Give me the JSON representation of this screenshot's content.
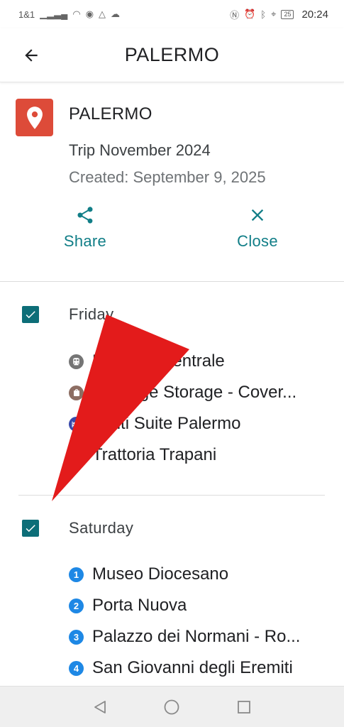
{
  "status_bar": {
    "carrier": "1&1",
    "time": "20:24",
    "battery": "25"
  },
  "app_bar": {
    "title": "PALERMO"
  },
  "map_header": {
    "name": "PALERMO",
    "description": "Trip November 2024",
    "created": "Created: September 9, 2025",
    "share_label": "Share",
    "close_label": "Close",
    "accent_color": "#117e87",
    "pin_color": "#dd4b39"
  },
  "days": [
    {
      "name": "Friday",
      "checked": true,
      "places": [
        {
          "text": "Palermo Centrale",
          "icon": "train-icon"
        },
        {
          "text": "Luggage Storage - Cover...",
          "icon": "shopping-bag-icon"
        },
        {
          "text": "Politi Suite Palermo",
          "icon": "hotel-icon"
        },
        {
          "text": "Trattoria Trapani",
          "icon": "restaurant-icon"
        }
      ]
    },
    {
      "name": "Saturday",
      "checked": true,
      "places": [
        {
          "text": "Museo Diocesano",
          "number": "1"
        },
        {
          "text": "Porta Nuova",
          "number": "2"
        },
        {
          "text": "Palazzo dei Normani - Ro...",
          "number": "3"
        },
        {
          "text": "San Giovanni degli Eremiti",
          "number": "4"
        }
      ]
    }
  ],
  "overlay": {
    "annotation": "red-arrow-pointing-to-saturday-checkbox",
    "color": "#e31b1b"
  }
}
